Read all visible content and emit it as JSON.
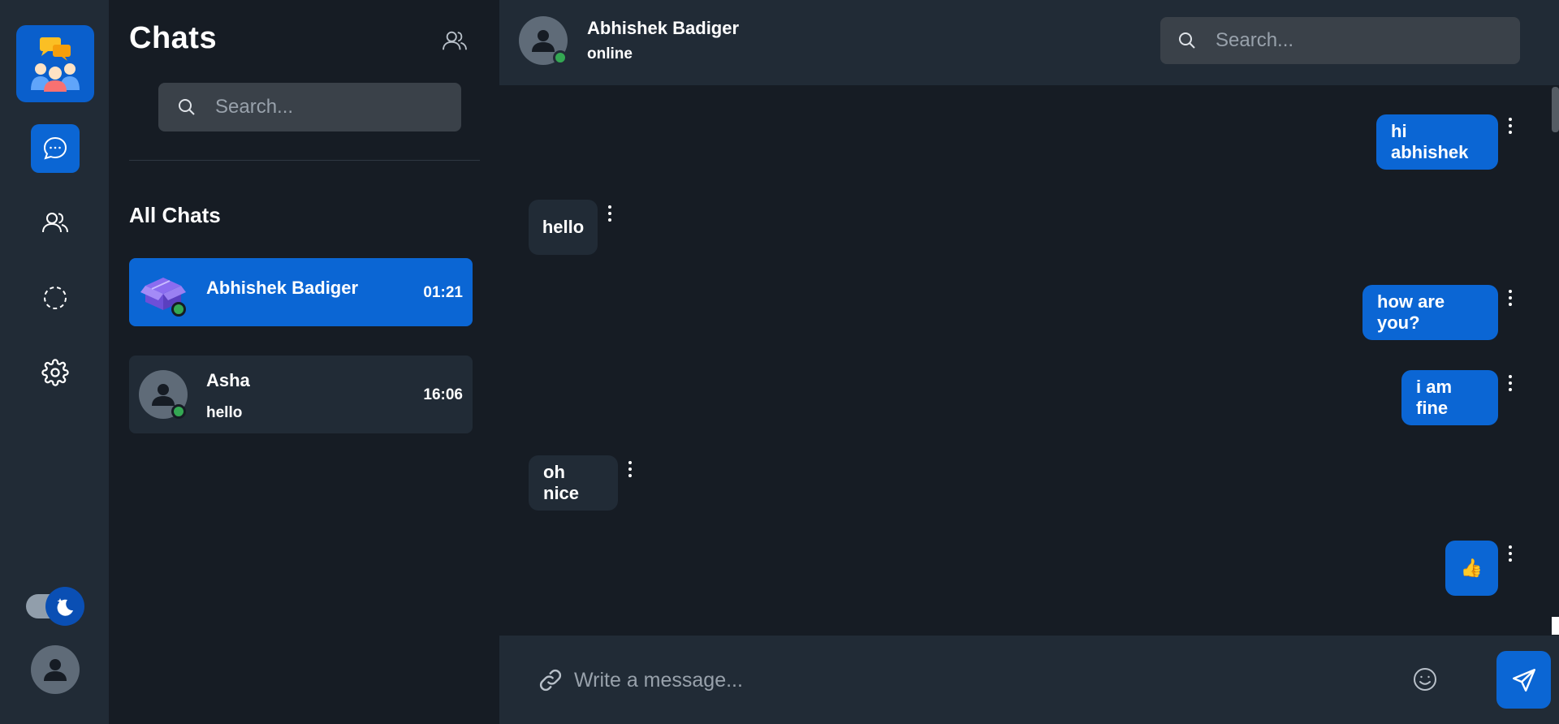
{
  "sidebar": {
    "nav": [
      {
        "icon": "chat-bubble-icon",
        "active": true
      },
      {
        "icon": "users-icon",
        "active": false
      },
      {
        "icon": "stories-icon",
        "active": false
      },
      {
        "icon": "gear-icon",
        "active": false
      }
    ],
    "theme": "dark"
  },
  "chat_list": {
    "title": "Chats",
    "search_placeholder": "Search...",
    "section_title": "All Chats",
    "chats": [
      {
        "name": "Abhishek Badiger",
        "time": "01:21",
        "preview": "",
        "online": true,
        "active": true
      },
      {
        "name": "Asha",
        "time": "16:06",
        "preview": "hello",
        "online": true,
        "active": false
      }
    ]
  },
  "conversation": {
    "contact_name": "Abhishek Badiger",
    "status": "online",
    "search_placeholder": "Search...",
    "messages": [
      {
        "text": "hi abhishek",
        "direction": "outgoing"
      },
      {
        "text": "hello",
        "direction": "incoming"
      },
      {
        "text": "how are you?",
        "direction": "outgoing"
      },
      {
        "text": "i am fine",
        "direction": "outgoing"
      },
      {
        "text": "oh nice",
        "direction": "incoming"
      },
      {
        "text": "👍",
        "direction": "outgoing"
      }
    ],
    "composer_placeholder": "Write a message..."
  },
  "colors": {
    "accent": "#0b66d4",
    "background": "#161c24",
    "surface": "#212b36",
    "online": "#34a853"
  }
}
